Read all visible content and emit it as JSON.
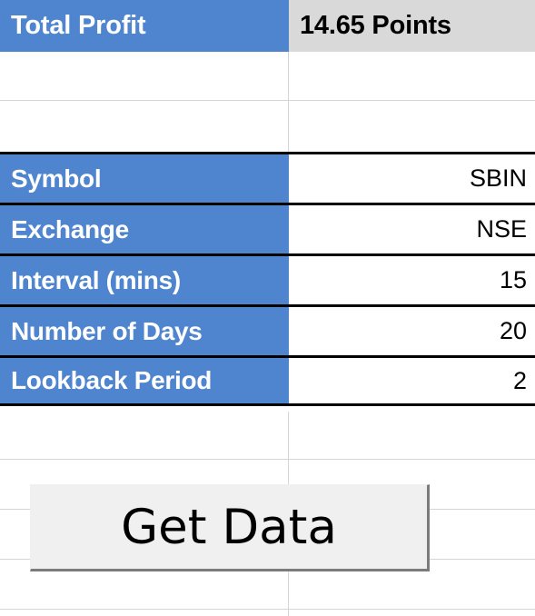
{
  "summary": {
    "label": "Total Profit",
    "value": "14.65 Points"
  },
  "parameters": {
    "rows": [
      {
        "key": "Symbol",
        "value": "SBIN"
      },
      {
        "key": "Exchange",
        "value": "NSE"
      },
      {
        "key": "Interval (mins)",
        "value": "15"
      },
      {
        "key": "Number of Days",
        "value": "20"
      },
      {
        "key": "Lookback Period",
        "value": "2"
      }
    ]
  },
  "actions": {
    "get_data_label": "Get Data"
  },
  "colors": {
    "header_blue": "#4e85ce",
    "summary_gray": "#d9d9d9",
    "button_face": "#f0f0f0",
    "button_shadow": "#7b7b7b",
    "gridline": "#d4d4d4",
    "border_dark": "#000000"
  }
}
